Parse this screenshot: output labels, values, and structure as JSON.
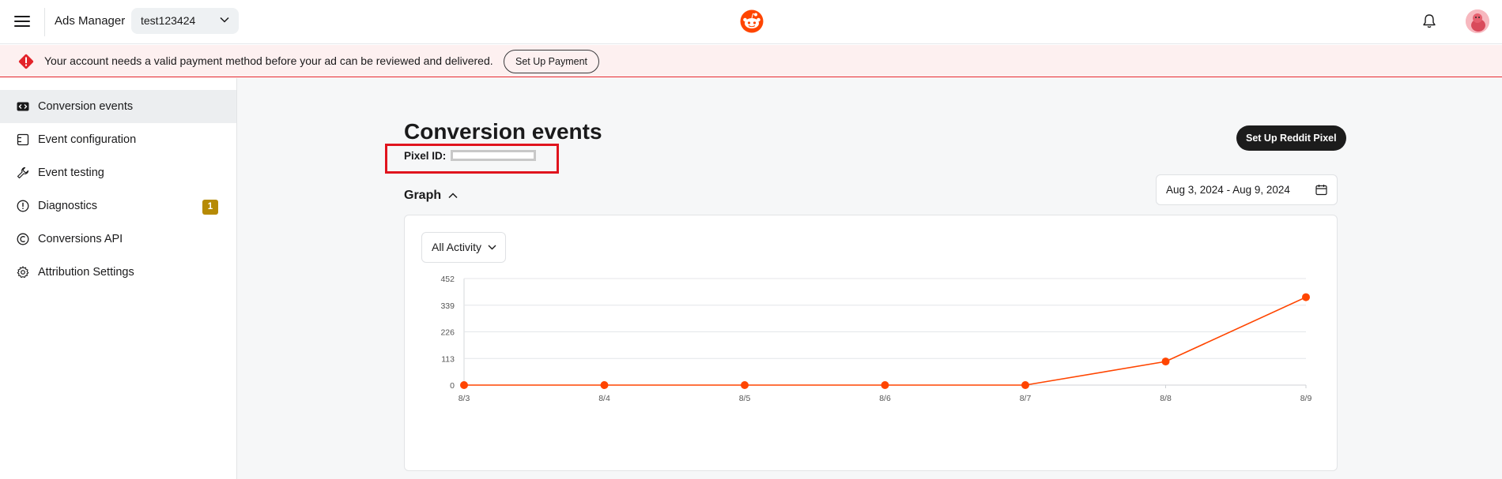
{
  "header": {
    "app_title": "Ads Manager",
    "account_name": "test123424",
    "menu_icon": "hamburger-menu-icon",
    "logo_icon": "reddit-logo-icon",
    "notification_icon": "bell-icon",
    "avatar_icon": "user-avatar-icon"
  },
  "banner": {
    "message": "Your account needs a valid payment method before your ad can be reviewed and delivered.",
    "button_label": "Set Up Payment",
    "icon": "warning-icon",
    "accent_color": "#e3242b"
  },
  "sidebar": {
    "items": [
      {
        "label": "Conversion events",
        "icon": "code-icon",
        "active": true
      },
      {
        "label": "Event configuration",
        "icon": "configure-icon",
        "active": false
      },
      {
        "label": "Event testing",
        "icon": "wrench-icon",
        "active": false
      },
      {
        "label": "Diagnostics",
        "icon": "alert-circle-icon",
        "active": false,
        "badge": "1"
      },
      {
        "label": "Conversions API",
        "icon": "api-icon",
        "active": false
      },
      {
        "label": "Attribution Settings",
        "icon": "gear-icon",
        "active": false
      }
    ]
  },
  "main": {
    "title": "Conversion events",
    "pixel_label": "Pixel ID:",
    "pixel_button": "Set Up Reddit Pixel",
    "graph_toggle": "Graph",
    "date_range": "Aug 3, 2024 - Aug 9, 2024",
    "activity_filter": "All Activity"
  },
  "chart_data": {
    "type": "line",
    "categories": [
      "8/3",
      "8/4",
      "8/5",
      "8/6",
      "8/7",
      "8/8",
      "8/9"
    ],
    "series": [
      {
        "values": [
          0,
          0,
          0,
          0,
          0,
          100,
          373
        ]
      }
    ],
    "yticks": [
      0,
      113,
      226,
      339,
      452
    ],
    "ylim": [
      0,
      452
    ],
    "line_color": "#ff4500",
    "grid": true
  }
}
